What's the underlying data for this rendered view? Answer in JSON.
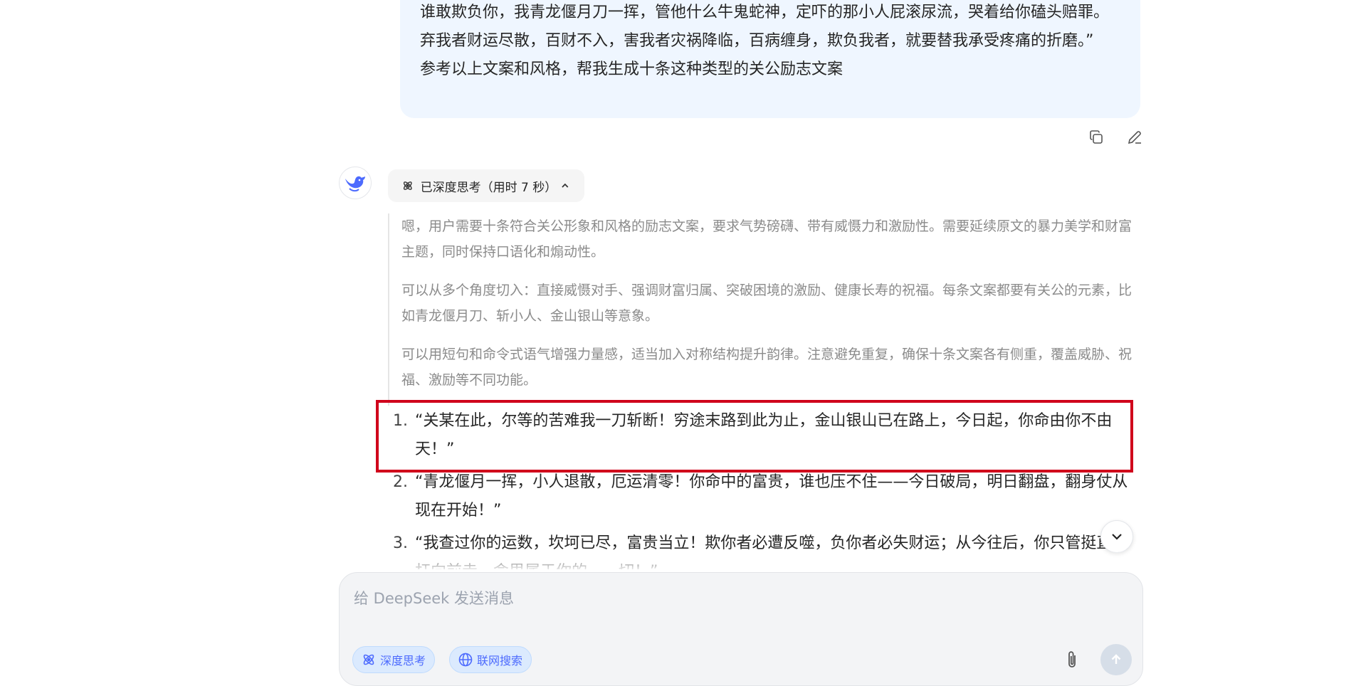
{
  "user_message": {
    "lines": [
      "谁敢欺负你，我青龙偃月刀一挥，管他什么牛鬼蛇神，定吓的那小人屁滚尿流，哭着给你磕头赔罪。",
      "弃我者财运尽散，百财不入，害我者灾祸降临，百病缠身，欺负我者，就要替我承受疼痛的折磨。”",
      "参考以上文案和风格，帮我生成十条这种类型的关公励志文案"
    ]
  },
  "message_actions": {
    "copy_icon": "copy-icon",
    "edit_icon": "edit-icon"
  },
  "assistant": {
    "avatar_icon": "deepseek-whale-icon",
    "thinking_label": "已深度思考（用时 7 秒）",
    "thinking_paragraphs": [
      "嗯，用户需要十条符合关公形象和风格的励志文案，要求气势磅礴、带有威慑力和激励性。需要延续原文的暴力美学和财富主题，同时保持口语化和煽动性。",
      "可以从多个角度切入：直接威慑对手、强调财富归属、突破困境的激励、健康长寿的祝福。每条文案都要有关公的元素，比如青龙偃月刀、斩小人、金山银山等意象。",
      "可以用短句和命令式语气增强力量感，适当加入对称结构提升韵律。注意避免重复，确保十条文案各有侧重，覆盖威胁、祝福、激励等不同功能。"
    ],
    "answers": [
      {
        "num": "1.",
        "text": "“关某在此，尔等的苦难我一刀斩断！穷途末路到此为止，金山银山已在路上，今日起，你命由你不由天！”"
      },
      {
        "num": "2.",
        "text": "“青龙偃月一挥，小人退散，厄运清零！你命中的富贵，谁也压不住——今日破局，明日翻盘，翻身仗从现在开始！”"
      },
      {
        "num": "3.",
        "text": "“我查过你的运数，坎坷已尽，富贵当立！欺你者必遭反噬，负你者必失财运；从今往后，你只管挺直腰杆向前走，命里属于你的，一切！”"
      }
    ]
  },
  "composer": {
    "placeholder": "给 DeepSeek 发送消息",
    "deep_think_label": "深度思考",
    "web_search_label": "联网搜索"
  },
  "colors": {
    "accent": "#4d6bfe",
    "highlight_box": "#d0021b",
    "bubble": "#eff6ff"
  }
}
